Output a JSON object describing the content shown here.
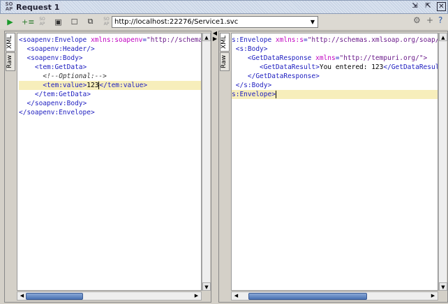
{
  "window": {
    "title": "Request 1",
    "logo": "SO AP"
  },
  "toolbar": {
    "url": "http://localhost:22276/Service1.svc",
    "icons": [
      "run-icon",
      "add-assertion-icon",
      "soap-icon",
      "grid-icon",
      "single-page-icon",
      "copy-icon",
      "soap-icon",
      "stop-icon"
    ]
  },
  "request": {
    "tabs": [
      "XML",
      "Raw"
    ],
    "lines": [
      {
        "indent": 0,
        "tag": "<soapenv:Envelope ",
        "attr": "xmlns:soapenv",
        "eq": "=",
        "val": "\"http://schemas.xmlsoap.org/soap/envelope/\" xmlns:tem=\"http://tempuri.org/\">"
      },
      {
        "indent": 2,
        "tag": "<soapenv:Header/>"
      },
      {
        "indent": 2,
        "tag": "<soapenv:Body>"
      },
      {
        "indent": 4,
        "tag": "<tem:GetData>"
      },
      {
        "indent": 6,
        "comment": "<!--Optional:-->"
      },
      {
        "indent": 6,
        "tag": "<tem:value>",
        "text": "123",
        "close": "</tem:value>"
      },
      {
        "indent": 4,
        "tag": "</tem:GetData>"
      },
      {
        "indent": 2,
        "tag": "</soapenv:Body>"
      },
      {
        "indent": 0,
        "tag": "</soapenv:Envelope>"
      }
    ]
  },
  "response": {
    "tabs": [
      "XML",
      "Raw"
    ],
    "lines": [
      {
        "tag": "s:Envelope ",
        "attr": "xmlns:s",
        "eq": "=",
        "val": "\"http://schemas.xmlsoap.org/soap/envelope/\">"
      },
      {
        "tag": " <s:Body>"
      },
      {
        "tag": "    <GetDataResponse ",
        "attr": "xmlns",
        "eq": "=",
        "val": "\"http://tempuri.org/\">"
      },
      {
        "tag": "       <GetDataResult>",
        "text": "You entered: 123",
        "close": "</GetDataResult>"
      },
      {
        "tag": "    </GetDataResponse>"
      },
      {
        "tag": " </s:Body>"
      },
      {
        "tag": "s:Envelope>"
      }
    ]
  }
}
